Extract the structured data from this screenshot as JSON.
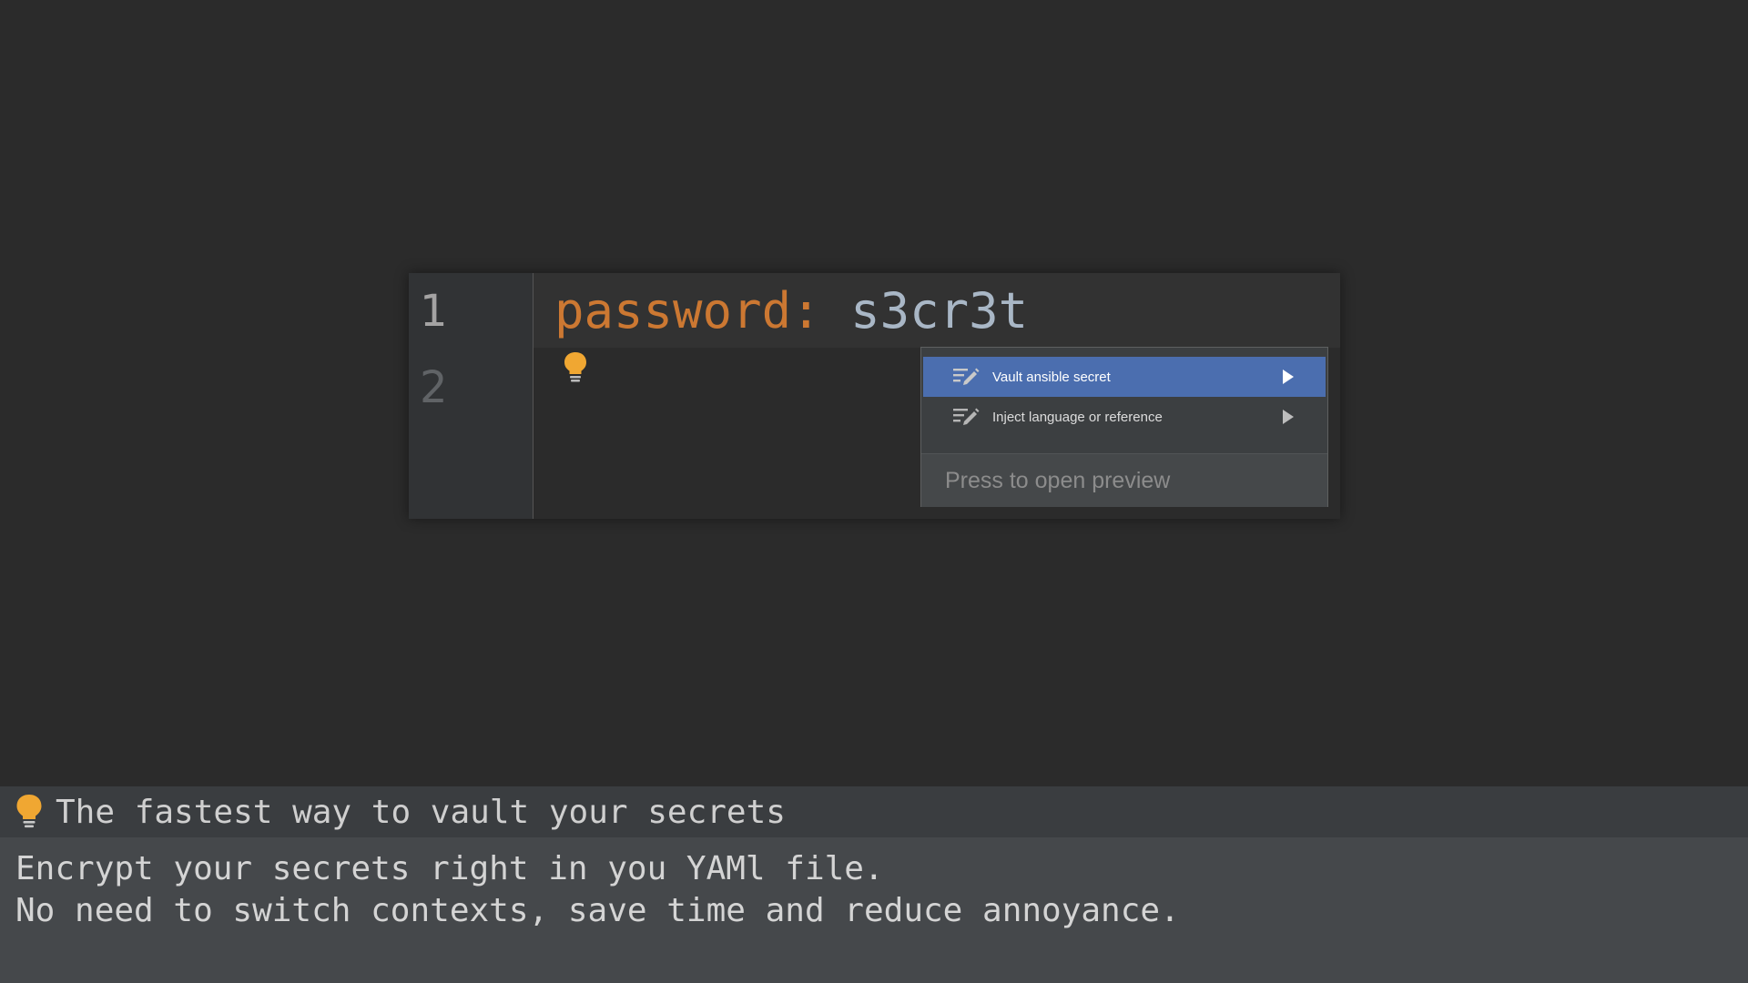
{
  "editor": {
    "line_numbers": [
      "1",
      "2"
    ],
    "code": {
      "key": "password",
      "colon": ":",
      "value": " s3cr3t"
    },
    "colors": {
      "key": "#cc7832",
      "value": "#a9b7c6",
      "background": "#2b2b2b",
      "gutter": "#313335"
    },
    "gutter_icon": "lightbulb-icon"
  },
  "popup": {
    "items": [
      {
        "label": "Vault ansible secret",
        "icon": "edit-icon",
        "selected": true
      },
      {
        "label": "Inject language or reference",
        "icon": "edit-icon",
        "selected": false
      }
    ],
    "footer": "Press to open preview",
    "selection_color": "#4b6eaf"
  },
  "tip": {
    "icon": "lightbulb-icon",
    "title": "The fastest way to vault your secrets",
    "lines": [
      "Encrypt your secrets right in you YAMl file.",
      "No need to switch contexts, save time and reduce annoyance."
    ],
    "bulb_color": "#f0a732"
  }
}
